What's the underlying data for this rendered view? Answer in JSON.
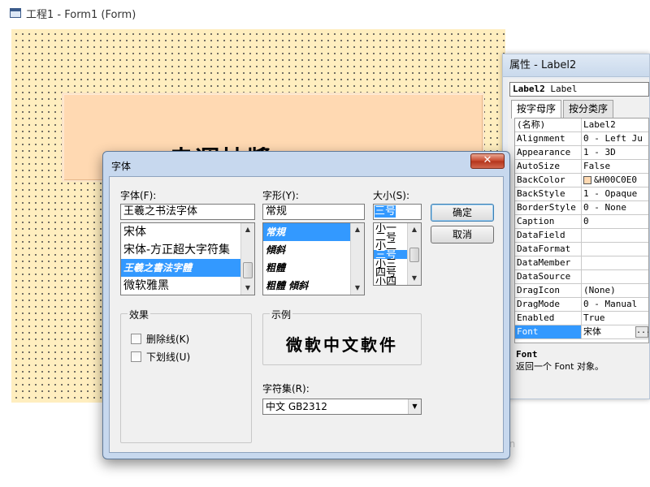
{
  "designer": {
    "title": "工程1 - Form1 (Form)",
    "label1_caption": "幸運抽獎"
  },
  "properties": {
    "title": "属性 - Label2",
    "object_selector": {
      "name": "Label2",
      "type": "Label"
    },
    "tabs": [
      "按字母序",
      "按分类序"
    ],
    "rows": [
      {
        "name": "(名称)",
        "value": "Label2"
      },
      {
        "name": "Alignment",
        "value": "0 - Left Ju"
      },
      {
        "name": "Appearance",
        "value": "1 - 3D"
      },
      {
        "name": "AutoSize",
        "value": "False"
      },
      {
        "name": "BackColor",
        "value": "&H00C0E0"
      },
      {
        "name": "BackStyle",
        "value": "1 - Opaque"
      },
      {
        "name": "BorderStyle",
        "value": "0 - None"
      },
      {
        "name": "Caption",
        "value": "0"
      },
      {
        "name": "DataField",
        "value": ""
      },
      {
        "name": "DataFormat",
        "value": ""
      },
      {
        "name": "DataMember",
        "value": ""
      },
      {
        "name": "DataSource",
        "value": ""
      },
      {
        "name": "DragIcon",
        "value": "(None)"
      },
      {
        "name": "DragMode",
        "value": "0 - Manual"
      },
      {
        "name": "Enabled",
        "value": "True"
      },
      {
        "name": "Font",
        "value": "宋体"
      }
    ],
    "ellipsis": "...",
    "description": {
      "title": "Font",
      "text": "返回一个 Font 对象。"
    }
  },
  "font_dialog": {
    "title": "字体",
    "close": "✕",
    "font_label": "字体(F):",
    "font_value": "王羲之书法字体",
    "font_list": [
      "宋体",
      "宋体-方正超大字符集",
      "王羲之書法字體",
      "微软雅黑"
    ],
    "style_label": "字形(Y):",
    "style_value": "常规",
    "style_list": [
      "常規",
      "傾斜",
      "粗體",
      "粗體 傾斜"
    ],
    "size_label": "大小(S):",
    "size_value": "三号",
    "size_list": [
      "小一",
      "二号",
      "小二",
      "三号",
      "小三",
      "四号",
      "小四"
    ],
    "ok_label": "确定",
    "cancel_label": "取消",
    "effects_label": "效果",
    "strikeout_label": "删除线(K)",
    "underline_label": "下划线(U)",
    "sample_label": "示例",
    "sample_text": "微軟中文軟件",
    "script_label": "字符集(R):",
    "script_value": "中文 GB2312"
  },
  "watermark": "jin"
}
